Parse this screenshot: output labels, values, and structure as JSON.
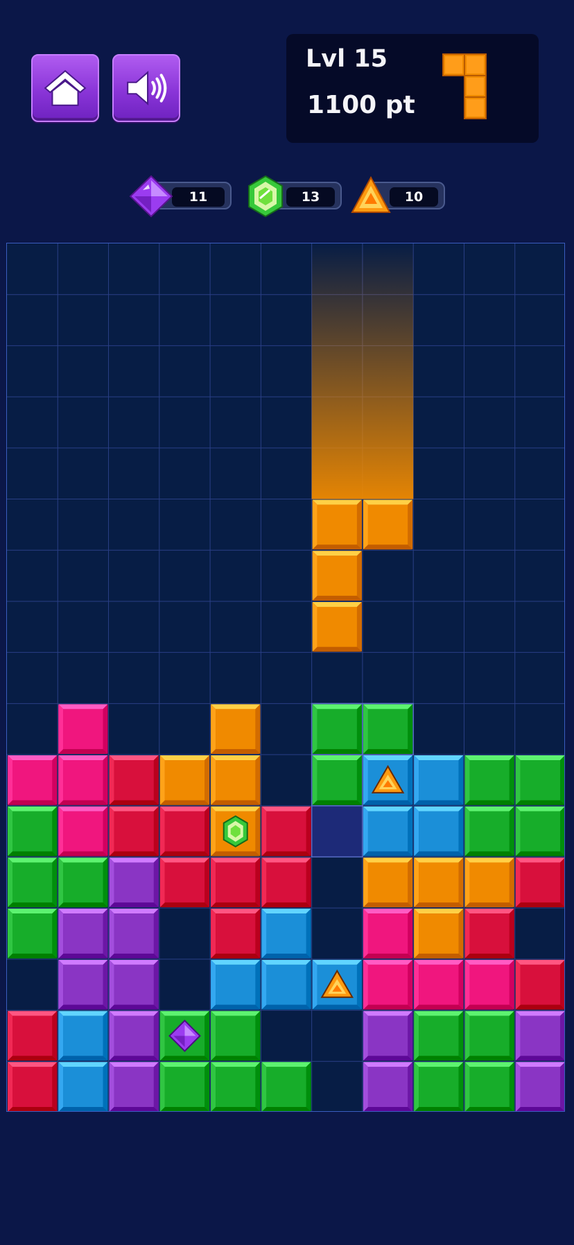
{
  "header": {
    "home_icon": "home-icon",
    "sound_icon": "speaker-sound-icon",
    "level_label": "Lvl 15",
    "score_label": "1100 pt",
    "next_piece_color": "#f08a00"
  },
  "gem_counters": [
    {
      "gem": "purple-diamond-gem",
      "value": "11",
      "color": "#9b3cf0"
    },
    {
      "gem": "green-hexagon-gem",
      "value": "13",
      "color": "#3ccf2c"
    },
    {
      "gem": "orange-triangle-gem",
      "value": "10",
      "color": "#ff9a10"
    }
  ],
  "colors": {
    "background": "#0b1748",
    "board": "#071d45",
    "grid_line": "#2a3f86",
    "pink": "#f0167e",
    "red": "#d8103c",
    "orange": "#f08a00",
    "green": "#17ad2a",
    "blue": "#1b8fd8",
    "purple": "#8a35c4",
    "ghost": "#1d2a78"
  },
  "board": {
    "columns": 11,
    "rows": 17,
    "cells": [
      "...........",
      "...........",
      "...........",
      "...........",
      "...........",
      "......OO...",
      "......O....",
      "......O....",
      "...........",
      ".P..O.GG...",
      "PPROO.GBBGG",
      "GPRROR.BBGG",
      "GGURRR.OOOR",
      "GUU.RB.POR R",
      ".UU.BBBPPPR",
      "RBUGG..UGGU",
      "RBUGGG.UGGU"
    ],
    "gems": [
      {
        "row": 10,
        "col": 7,
        "gem": "orange-triangle-gem"
      },
      {
        "row": 11,
        "col": 4,
        "gem": "green-hexagon-gem"
      },
      {
        "row": 14,
        "col": 6,
        "gem": "orange-triangle-gem"
      },
      {
        "row": 15,
        "col": 3,
        "gem": "purple-diamond-gem"
      }
    ],
    "falling_piece_trail": {
      "color": "#f08a00"
    }
  }
}
